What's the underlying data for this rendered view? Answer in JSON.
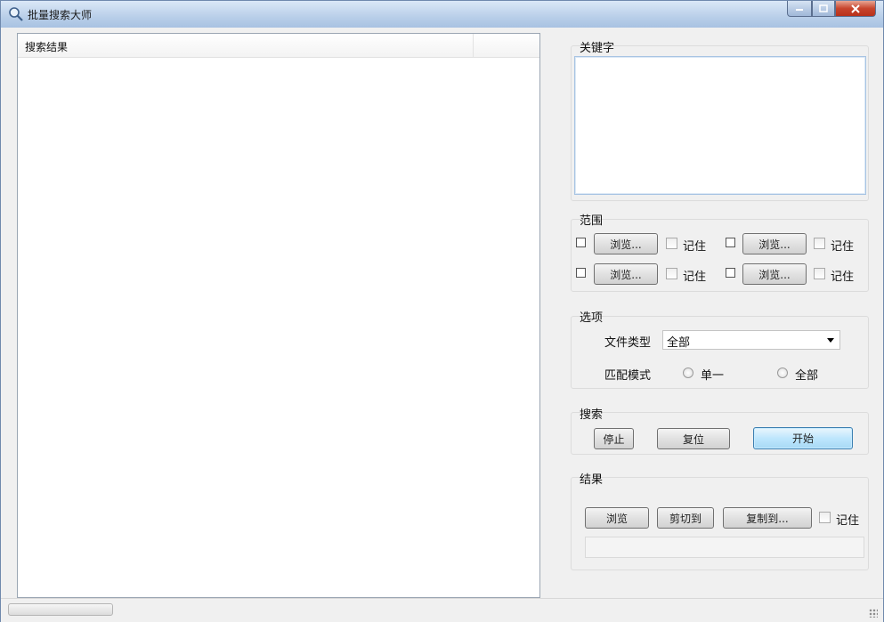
{
  "window": {
    "title": "批量搜索大师"
  },
  "results": {
    "column_header": "搜索结果"
  },
  "keyword": {
    "label": "关键字",
    "value": ""
  },
  "scope": {
    "label": "范围",
    "rows": [
      {
        "browse": "浏览...",
        "remember": "记住"
      },
      {
        "browse": "浏览...",
        "remember": "记住"
      },
      {
        "browse": "浏览...",
        "remember": "记住"
      },
      {
        "browse": "浏览...",
        "remember": "记住"
      }
    ]
  },
  "options": {
    "label": "选项",
    "file_type_label": "文件类型",
    "file_type_value": "全部",
    "match_mode_label": "匹配模式",
    "match_single": "单一",
    "match_all": "全部"
  },
  "search": {
    "label": "搜索",
    "stop": "停止",
    "reset": "复位",
    "start": "开始"
  },
  "result_actions": {
    "label": "结果",
    "browse": "浏览",
    "cut_to": "剪切到",
    "copy_to": "复制到...",
    "remember": "记住",
    "path": ""
  }
}
